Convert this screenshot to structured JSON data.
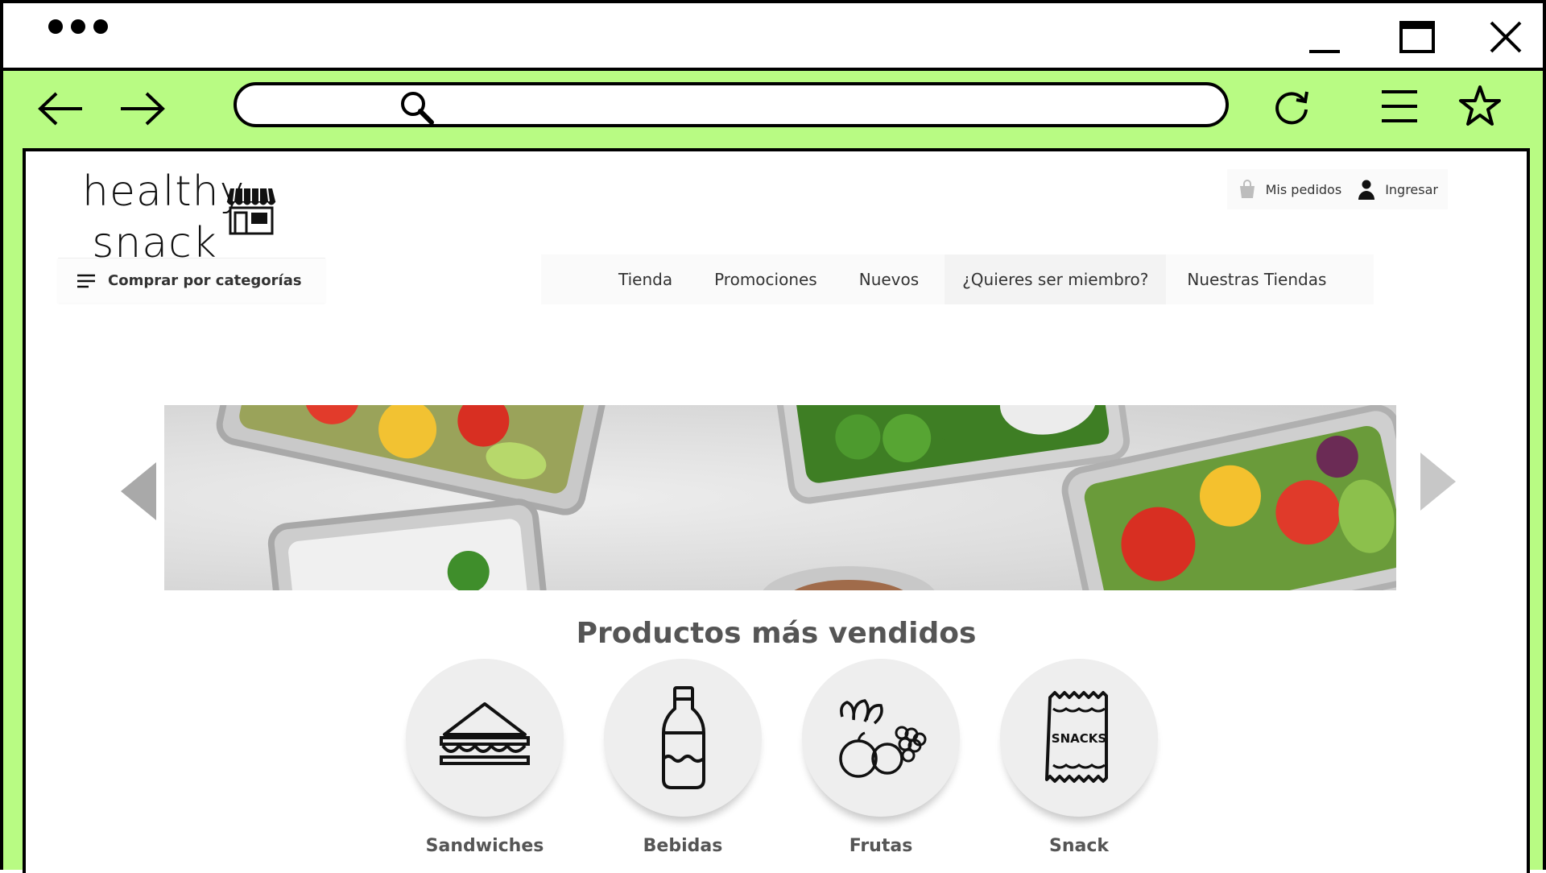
{
  "site": {
    "logo_line1": "healthy",
    "logo_line2": "snack"
  },
  "header_links": {
    "orders_label": "Mis pedidos",
    "login_label": "Ingresar"
  },
  "categories_label": "Comprar por categorías",
  "menu": [
    {
      "label": "Tienda"
    },
    {
      "label": "Promociones"
    },
    {
      "label": "Nuevos"
    },
    {
      "label": "¿Quieres ser miembro?"
    },
    {
      "label": "Nuestras Tiendas"
    }
  ],
  "section_title": "Productos más vendidos",
  "products": [
    {
      "label": "Sandwiches",
      "icon": "sandwich-icon"
    },
    {
      "label": "Bebidas",
      "icon": "bottle-icon"
    },
    {
      "label": "Frutas",
      "icon": "fruits-icon"
    },
    {
      "label": "Snack",
      "icon": "snacks-bag-icon"
    }
  ],
  "snack_bag_text": "SNACKS",
  "colors": {
    "browser_frame": "#b8fb83",
    "text_primary": "#333333",
    "section_title": "#555555",
    "circle_bg": "#eeeeee"
  }
}
